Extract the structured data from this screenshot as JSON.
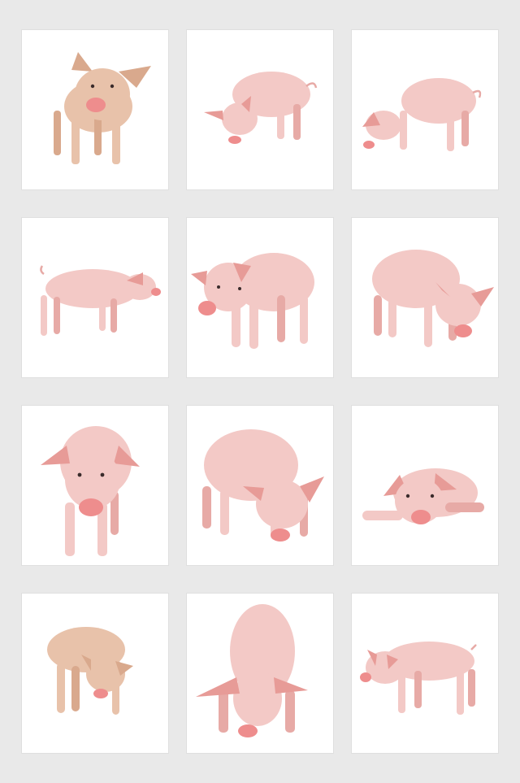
{
  "background_color": "#e9e9e9",
  "tile_color": "#ffffff",
  "pig_colors": {
    "body": "#f3c9c6",
    "body_shade": "#e7aaa6",
    "snout": "#ee8d8d",
    "ear": "#e79b97",
    "tan_body": "#e8c2aa",
    "tan_shade": "#d9a98d"
  },
  "tiles": [
    {
      "subject": "piglet-front-standing",
      "color": "tan"
    },
    {
      "subject": "pig-sniffing-left",
      "color": "pink"
    },
    {
      "subject": "pig-sniffing-left",
      "color": "pink"
    },
    {
      "subject": "piglet-side-right",
      "color": "pink"
    },
    {
      "subject": "piglet-walking-left",
      "color": "pink"
    },
    {
      "subject": "pig-sniffing-right",
      "color": "pink"
    },
    {
      "subject": "piglet-front-facing",
      "color": "pink"
    },
    {
      "subject": "pig-grazing-right",
      "color": "pink"
    },
    {
      "subject": "piglet-lying-down",
      "color": "pink"
    },
    {
      "subject": "piglet-grazing-right",
      "color": "tan"
    },
    {
      "subject": "pig-front-grazing",
      "color": "pink"
    },
    {
      "subject": "piglet-side-left",
      "color": "pink"
    }
  ]
}
